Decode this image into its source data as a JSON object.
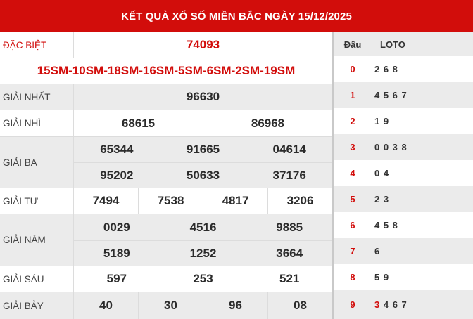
{
  "title": "KẾT QUẢ XỔ SỐ MIỀN BẮC NGÀY 15/12/2025",
  "results": {
    "special": {
      "label": "ĐẶC BIỆT",
      "value": "74093",
      "codes": "15SM-10SM-18SM-16SM-5SM-6SM-2SM-19SM"
    },
    "first": {
      "label": "GIẢI NHẤT",
      "values": [
        "96630"
      ]
    },
    "second": {
      "label": "GIẢI NHÌ",
      "values": [
        "68615",
        "86968"
      ]
    },
    "third": {
      "label": "GIẢI BA",
      "values": [
        "65344",
        "91665",
        "04614",
        "95202",
        "50633",
        "37176"
      ]
    },
    "fourth": {
      "label": "GIẢI TƯ",
      "values": [
        "7494",
        "7538",
        "4817",
        "3206"
      ]
    },
    "fifth": {
      "label": "GIẢI NĂM",
      "values": [
        "0029",
        "4516",
        "9885",
        "5189",
        "1252",
        "3664"
      ]
    },
    "sixth": {
      "label": "GIẢI SÁU",
      "values": [
        "597",
        "253",
        "521"
      ]
    },
    "seventh": {
      "label": "GIẢI BẢY",
      "values": [
        "40",
        "30",
        "96",
        "08"
      ]
    }
  },
  "loto": {
    "head_label": "Đầu",
    "loto_label": "LOTO",
    "rows": [
      {
        "head": "0",
        "tail": "2 6 8"
      },
      {
        "head": "1",
        "tail": "4 5 6 7"
      },
      {
        "head": "2",
        "tail": "1 9"
      },
      {
        "head": "3",
        "tail": "0 0 3 8"
      },
      {
        "head": "4",
        "tail": "0 4"
      },
      {
        "head": "5",
        "tail": "2 3"
      },
      {
        "head": "6",
        "tail": "4 5 8"
      },
      {
        "head": "7",
        "tail": "6"
      },
      {
        "head": "8",
        "tail": "5 9"
      },
      {
        "head": "9",
        "tail_first": "3",
        "tail": "4 6 7"
      }
    ]
  },
  "colors": {
    "header_bg": "#d20d0b",
    "accent": "#d20d0b",
    "alt_row": "#ebebeb"
  }
}
